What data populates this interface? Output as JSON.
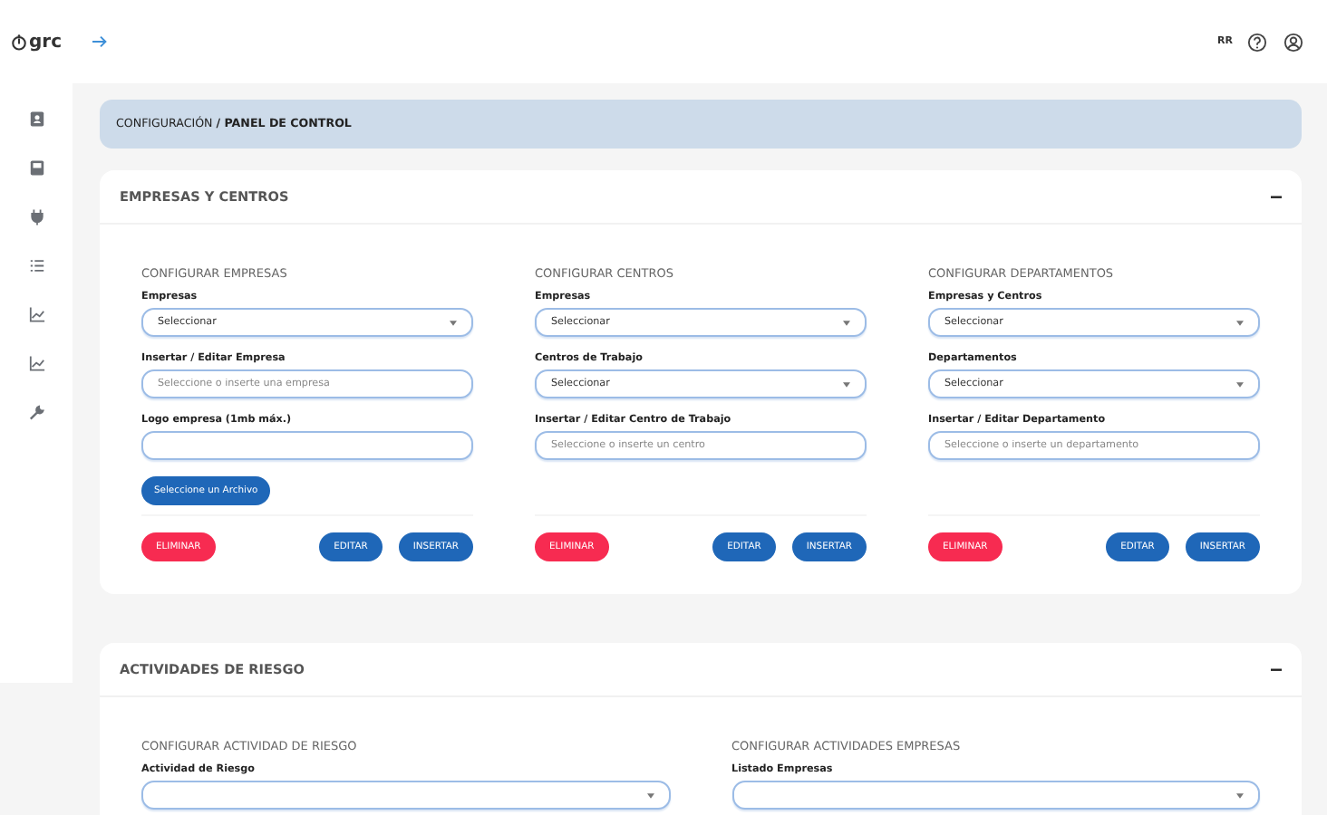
{
  "header": {
    "logo": "grc",
    "user_initials": "RR"
  },
  "breadcrumb": "CONFIGURACIÓN **/ PANEL DE CONTROL**",
  "sections": [
    {
      "title": "EMPRESAS Y CENTROS",
      "expanded": true,
      "columns": [
        {
          "title": "CONFIGURAR EMPRESAS",
          "fields": [
            {
              "kind": "select",
              "label": "Empresas",
              "value": "Seleccionar"
            },
            {
              "kind": "input",
              "label": "Insertar / Editar Empresa",
              "placeholder": "Seleccione o inserte una empresa"
            },
            {
              "kind": "input",
              "label": "Logo empresa (1mb máx.)"
            },
            {
              "kind": "file",
              "label": "Seleccione un Archivo"
            }
          ],
          "buttons": [
            {
              "kind": "danger",
              "label": "ELIMINAR"
            },
            {
              "kind": "primary",
              "label": "EDITAR"
            },
            {
              "kind": "primary",
              "label": "INSERTAR"
            }
          ]
        },
        {
          "title": "CONFIGURAR CENTROS",
          "fields": [
            {
              "kind": "select",
              "label": "Empresas",
              "value": "Seleccionar"
            },
            {
              "kind": "select",
              "label": "Centros de Trabajo",
              "value": "Seleccionar"
            },
            {
              "kind": "input",
              "label": "Insertar / Editar Centro de Trabajo",
              "placeholder": "Seleccione o inserte un centro"
            }
          ],
          "buttons": [
            {
              "kind": "danger",
              "label": "ELIMINAR"
            },
            {
              "kind": "primary",
              "label": "EDITAR"
            },
            {
              "kind": "primary",
              "label": "INSERTAR"
            }
          ]
        },
        {
          "title": "CONFIGURAR DEPARTAMENTOS",
          "fields": [
            {
              "kind": "select",
              "label": "Empresas y Centros",
              "value": "Seleccionar"
            },
            {
              "kind": "select",
              "label": "Departamentos",
              "value": "Seleccionar"
            },
            {
              "kind": "input",
              "label": "Insertar / Editar Departamento",
              "placeholder": "Seleccione o inserte un departamento"
            }
          ],
          "buttons": [
            {
              "kind": "danger",
              "label": "ELIMINAR"
            },
            {
              "kind": "primary",
              "label": "EDITAR"
            },
            {
              "kind": "primary",
              "label": "INSERTAR"
            }
          ]
        }
      ]
    },
    {
      "title": "ACTIVIDADES DE RIESGO",
      "expanded": true,
      "columns": [
        {
          "title": "CONFIGURAR ACTIVIDAD DE RIESGO",
          "fields": [
            {
              "kind": "select",
              "label": "Actividad de Riesgo"
            }
          ]
        },
        {
          "title": "CONFIGURAR ACTIVIDADES EMPRESAS",
          "fields": [
            {
              "kind": "select",
              "label": "Listado Empresas"
            }
          ]
        }
      ]
    }
  ]
}
